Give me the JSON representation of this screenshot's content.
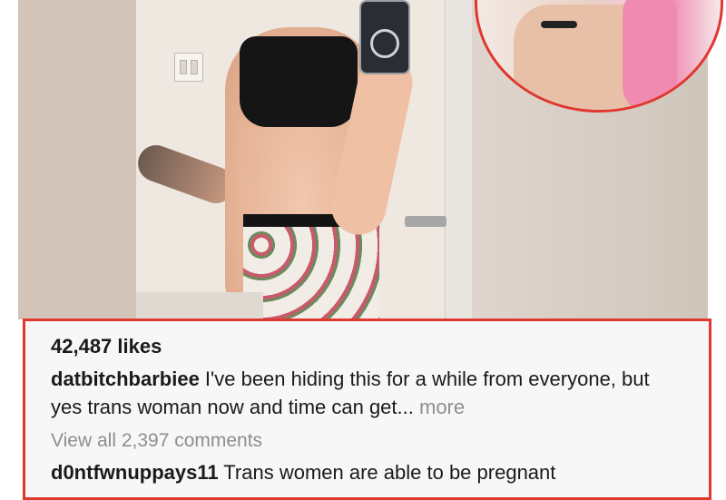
{
  "post": {
    "likes_text": "42,487 likes",
    "caption": {
      "username": "datbitchbarbiee",
      "text": " I've been hiding this for a while from everyone, but yes trans woman now and time can get...",
      "more_label": " more"
    },
    "view_comments_text": "View all 2,397 comments",
    "first_comment": {
      "username": "d0ntfwnuppays11",
      "text": " Trans women are able to be pregnant"
    }
  },
  "colors": {
    "highlight_border": "#e0372f",
    "muted_text": "#8e8e8e",
    "panel_background": "#f7f7f7"
  }
}
